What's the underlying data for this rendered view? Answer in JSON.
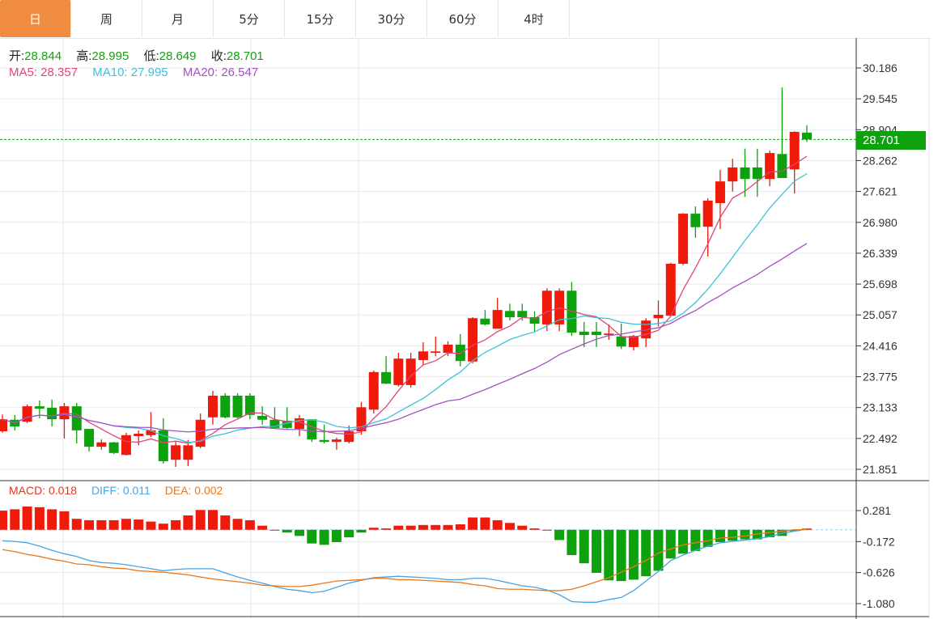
{
  "tabs": [
    {
      "label": "日",
      "active": true
    },
    {
      "label": "周"
    },
    {
      "label": "月"
    },
    {
      "label": "5分"
    },
    {
      "label": "15分"
    },
    {
      "label": "30分"
    },
    {
      "label": "60分"
    },
    {
      "label": "4时"
    }
  ],
  "ohlc_legend": {
    "open_label": "开:",
    "open": "28.844",
    "high_label": "高:",
    "high": "28.995",
    "low_label": "低:",
    "low": "28.649",
    "close_label": "收:",
    "close": "28.701"
  },
  "ma_legend": {
    "ma5": "MA5: 28.357",
    "ma10": "MA10: 27.995",
    "ma20": "MA20: 26.547"
  },
  "macd_legend": {
    "macd": "MACD: 0.018",
    "diff": "DIFF: 0.011",
    "dea": "DEA: 0.002"
  },
  "current_price": "28.701",
  "colors": {
    "up": "#f01a0a",
    "down": "#0ea10e",
    "ma5": "#e0457b",
    "ma10": "#3fc0d8",
    "ma20": "#a550c0",
    "diff": "#4aa3e0",
    "dea": "#e8781e",
    "active_tab": "#f08c3f"
  },
  "chart_data": [
    {
      "type": "candlestick",
      "ylim": [
        21.851,
        30.186
      ],
      "y_ticks": [
        "30.186",
        "29.545",
        "28.904",
        "28.262",
        "27.621",
        "26.980",
        "26.339",
        "25.698",
        "25.057",
        "24.416",
        "23.775",
        "23.133",
        "22.492",
        "21.851"
      ],
      "grid": true,
      "candles": [
        [
          22.64,
          22.99,
          22.61,
          22.89
        ],
        [
          22.88,
          22.98,
          22.66,
          22.74
        ],
        [
          22.84,
          23.2,
          22.81,
          23.16
        ],
        [
          23.16,
          23.28,
          22.91,
          23.11
        ],
        [
          23.13,
          23.3,
          22.74,
          22.89
        ],
        [
          22.89,
          23.23,
          22.49,
          23.16
        ],
        [
          23.16,
          23.23,
          22.39,
          22.66
        ],
        [
          22.69,
          22.69,
          22.22,
          22.32
        ],
        [
          22.32,
          22.47,
          22.26,
          22.41
        ],
        [
          22.41,
          22.42,
          22.17,
          22.19
        ],
        [
          22.15,
          22.61,
          22.14,
          22.56
        ],
        [
          22.54,
          22.66,
          22.35,
          22.59
        ],
        [
          22.56,
          23.04,
          22.52,
          22.66
        ],
        [
          22.66,
          22.91,
          21.97,
          22.02
        ],
        [
          22.05,
          22.42,
          21.9,
          22.35
        ],
        [
          22.05,
          22.46,
          21.92,
          22.35
        ],
        [
          22.32,
          23.01,
          22.29,
          22.88
        ],
        [
          22.93,
          23.48,
          22.78,
          23.38
        ],
        [
          23.38,
          23.43,
          22.91,
          22.93
        ],
        [
          23.38,
          23.43,
          22.91,
          22.93
        ],
        [
          23.38,
          23.43,
          22.89,
          22.98
        ],
        [
          22.96,
          23.16,
          22.78,
          22.88
        ],
        [
          22.88,
          23.14,
          22.69,
          22.71
        ],
        [
          22.86,
          23.14,
          22.69,
          22.71
        ],
        [
          22.69,
          22.98,
          22.54,
          22.91
        ],
        [
          22.89,
          22.89,
          22.42,
          22.47
        ],
        [
          22.46,
          22.78,
          22.39,
          22.42
        ],
        [
          22.42,
          22.51,
          22.26,
          22.47
        ],
        [
          22.42,
          22.76,
          22.39,
          22.64
        ],
        [
          22.64,
          23.25,
          22.57,
          23.14
        ],
        [
          23.09,
          23.9,
          23.01,
          23.87
        ],
        [
          23.87,
          24.2,
          23.62,
          23.63
        ],
        [
          23.6,
          24.27,
          23.57,
          24.15
        ],
        [
          23.6,
          24.27,
          23.55,
          24.15
        ],
        [
          24.12,
          24.49,
          24.01,
          24.3
        ],
        [
          24.27,
          24.61,
          24.2,
          24.3
        ],
        [
          24.27,
          24.51,
          24.2,
          24.44
        ],
        [
          24.44,
          24.66,
          23.99,
          24.1
        ],
        [
          24.09,
          25.01,
          24.05,
          24.99
        ],
        [
          24.98,
          25.16,
          24.84,
          24.86
        ],
        [
          24.77,
          25.41,
          24.77,
          25.16
        ],
        [
          25.14,
          25.29,
          24.94,
          25.01
        ],
        [
          25.14,
          25.29,
          24.94,
          25.01
        ],
        [
          25.01,
          25.13,
          24.71,
          24.875
        ],
        [
          24.86,
          25.61,
          24.72,
          25.56
        ],
        [
          24.86,
          25.61,
          24.72,
          25.56
        ],
        [
          25.56,
          25.74,
          24.62,
          24.69
        ],
        [
          24.71,
          24.91,
          24.39,
          24.64
        ],
        [
          24.71,
          24.91,
          24.39,
          24.64
        ],
        [
          24.64,
          24.86,
          24.54,
          24.67
        ],
        [
          24.61,
          24.875,
          24.35,
          24.4
        ],
        [
          24.39,
          24.64,
          24.32,
          24.62
        ],
        [
          24.57,
          24.99,
          24.39,
          24.94
        ],
        [
          24.99,
          25.36,
          24.82,
          25.06
        ],
        [
          25.04,
          26.14,
          25.04,
          26.12
        ],
        [
          26.12,
          27.17,
          26.09,
          27.16
        ],
        [
          27.16,
          27.31,
          26.66,
          26.88
        ],
        [
          26.89,
          27.48,
          26.27,
          27.43
        ],
        [
          27.38,
          28.07,
          26.84,
          27.83
        ],
        [
          27.83,
          28.3,
          27.62,
          28.12
        ],
        [
          28.12,
          28.51,
          27.51,
          27.88
        ],
        [
          28.12,
          28.51,
          27.51,
          27.88
        ],
        [
          27.88,
          28.47,
          27.73,
          28.42
        ],
        [
          28.4,
          29.78,
          27.9,
          27.9
        ],
        [
          28.08,
          28.87,
          27.58,
          28.86
        ],
        [
          28.844,
          28.995,
          28.649,
          28.701
        ]
      ],
      "candle_fields": [
        "open",
        "high",
        "low",
        "close"
      ],
      "ma_periods": [
        5,
        10,
        20
      ]
    },
    {
      "type": "macd",
      "ylim": [
        -1.08,
        0.281
      ],
      "y_ticks": [
        "0.281",
        "-0.172",
        "-0.626",
        "-1.080"
      ],
      "histogram": [
        0.28,
        0.3,
        0.34,
        0.33,
        0.3,
        0.27,
        0.16,
        0.14,
        0.14,
        0.14,
        0.16,
        0.15,
        0.12,
        0.09,
        0.14,
        0.21,
        0.29,
        0.29,
        0.21,
        0.16,
        0.14,
        0.06,
        0.0,
        -0.04,
        -0.09,
        -0.2,
        -0.22,
        -0.18,
        -0.11,
        -0.04,
        0.03,
        0.02,
        0.06,
        0.06,
        0.07,
        0.07,
        0.07,
        0.08,
        0.18,
        0.18,
        0.14,
        0.1,
        0.06,
        0.02,
        0.0,
        -0.15,
        -0.37,
        -0.49,
        -0.63,
        -0.74,
        -0.75,
        -0.73,
        -0.68,
        -0.6,
        -0.42,
        -0.35,
        -0.31,
        -0.25,
        -0.18,
        -0.16,
        -0.14,
        -0.14,
        -0.11,
        -0.09,
        -0.02,
        0.018
      ],
      "diff": [
        -0.16,
        -0.17,
        -0.19,
        -0.24,
        -0.3,
        -0.35,
        -0.39,
        -0.45,
        -0.48,
        -0.49,
        -0.51,
        -0.54,
        -0.57,
        -0.6,
        -0.58,
        -0.57,
        -0.57,
        -0.57,
        -0.63,
        -0.69,
        -0.74,
        -0.78,
        -0.83,
        -0.87,
        -0.89,
        -0.92,
        -0.9,
        -0.84,
        -0.78,
        -0.74,
        -0.7,
        -0.69,
        -0.68,
        -0.69,
        -0.7,
        -0.71,
        -0.73,
        -0.73,
        -0.71,
        -0.71,
        -0.74,
        -0.78,
        -0.82,
        -0.84,
        -0.88,
        -0.95,
        -1.05,
        -1.06,
        -1.06,
        -1.02,
        -0.99,
        -0.89,
        -0.75,
        -0.61,
        -0.45,
        -0.37,
        -0.3,
        -0.24,
        -0.19,
        -0.17,
        -0.15,
        -0.13,
        -0.1,
        -0.05,
        -0.02,
        0.011
      ],
      "dea": [
        -0.29,
        -0.32,
        -0.36,
        -0.39,
        -0.43,
        -0.46,
        -0.5,
        -0.51,
        -0.54,
        -0.56,
        -0.57,
        -0.6,
        -0.61,
        -0.62,
        -0.64,
        -0.66,
        -0.69,
        -0.72,
        -0.74,
        -0.76,
        -0.78,
        -0.81,
        -0.82,
        -0.83,
        -0.83,
        -0.81,
        -0.78,
        -0.75,
        -0.74,
        -0.73,
        -0.71,
        -0.71,
        -0.73,
        -0.73,
        -0.74,
        -0.75,
        -0.76,
        -0.77,
        -0.8,
        -0.82,
        -0.86,
        -0.87,
        -0.87,
        -0.88,
        -0.89,
        -0.89,
        -0.87,
        -0.82,
        -0.76,
        -0.7,
        -0.62,
        -0.54,
        -0.45,
        -0.34,
        -0.28,
        -0.22,
        -0.19,
        -0.16,
        -0.12,
        -0.11,
        -0.09,
        -0.06,
        -0.04,
        -0.02,
        0.0,
        0.002
      ]
    }
  ]
}
